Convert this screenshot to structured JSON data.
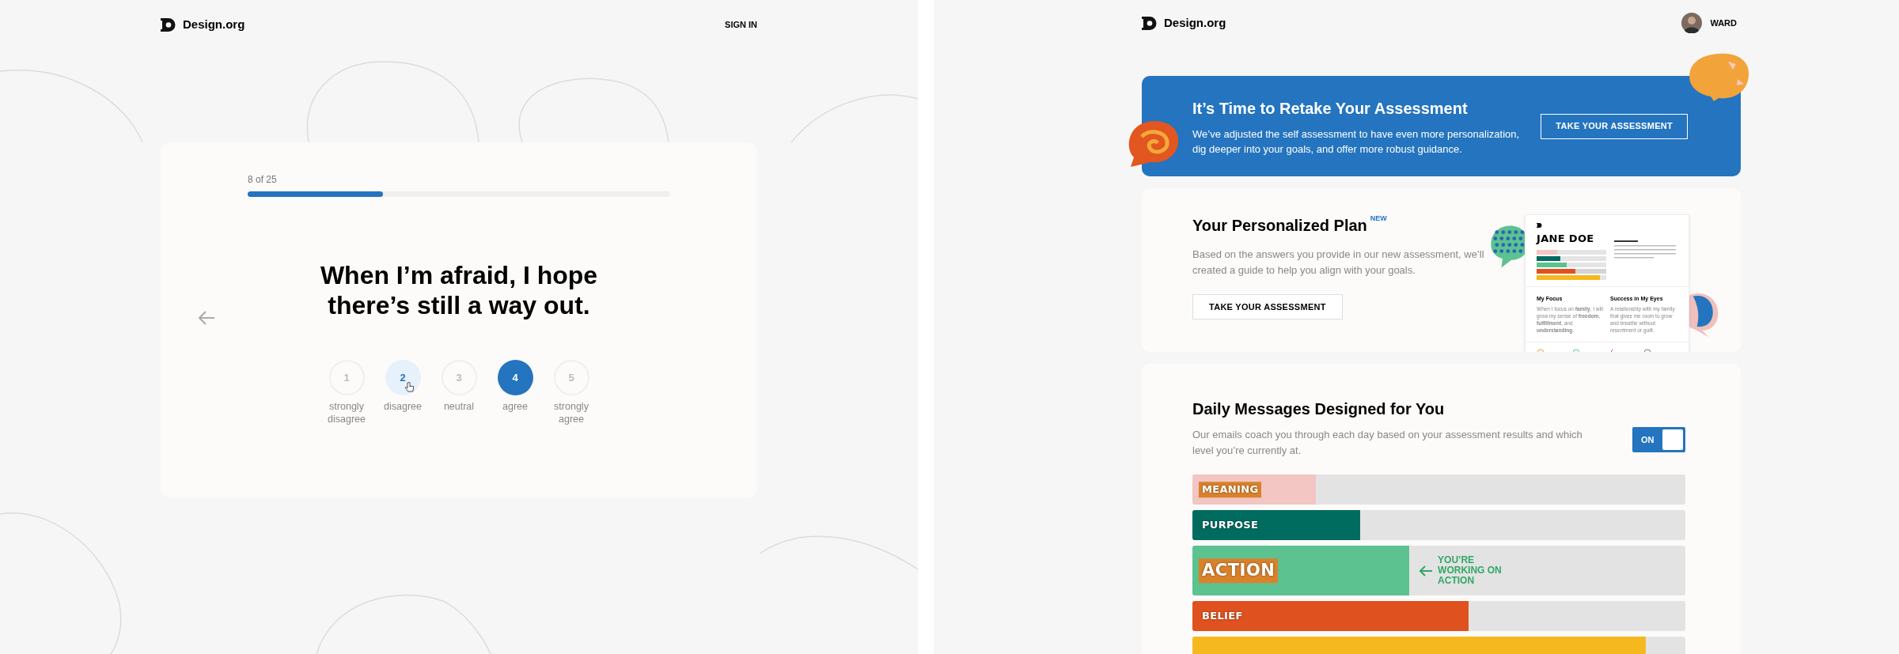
{
  "quiz_page": {
    "logo": "Design.org",
    "sign_in": "SIGN IN",
    "progress": {
      "label": "8 of 25",
      "level": 0.32
    },
    "question": "When I’m afraid, I hope there’s still a way out.",
    "options": [
      {
        "number": "1",
        "label": "strongly disagree",
        "selected": false,
        "hovered": false
      },
      {
        "number": "2",
        "label": "disagree",
        "selected": false,
        "hovered": true
      },
      {
        "number": "3",
        "label": "neutral",
        "selected": false,
        "hovered": false
      },
      {
        "number": "4",
        "label": "agree",
        "selected": true,
        "hovered": false
      },
      {
        "number": "5",
        "label": "strongly agree",
        "selected": false,
        "hovered": false
      }
    ]
  },
  "dashboard": {
    "logo": "Design.org",
    "user": {
      "name": "WARD"
    },
    "banner": {
      "title": "It’s Time to Retake Your Assessment",
      "text": "We’ve adjusted the self assessment to have even more personalization, dig deeper into your goals, and offer more robust guidance.",
      "button": "TAKE YOUR ASSESSMENT"
    },
    "plan": {
      "title": "Your Personalized Plan",
      "badge": "NEW",
      "text": "Based on the answers you provide in our new assessment, we’ll created a guide to help you align with your goals.",
      "button": "TAKE YOUR ASSESSMENT",
      "preview": {
        "name": "JANE DOE",
        "focus_heading": "My Focus",
        "focus_text": "When I focus on **family**, I will grow my sense of **freedom**, **fulfillment**, and **understanding**.",
        "success_heading": "Success in My Eyes",
        "success_text": "A relationship with my family that gives me room to grow and breathe without resentment or guilt."
      }
    },
    "daily": {
      "title": "Daily Messages Designed for You",
      "text": "Our emails coach you through each day based on your assessment results and which level you’re currently at.",
      "toggle": {
        "label": "ON",
        "on": true
      },
      "levels": [
        {
          "label": "MEANING",
          "color": "#f3c5c3",
          "level": 0.25,
          "current": false
        },
        {
          "label": "PURPOSE",
          "color": "#006b5f",
          "level": 0.34,
          "current": false
        },
        {
          "label": "ACTION",
          "color": "#5cc290",
          "level": 0.44,
          "current": true,
          "note": "YOU’RE WORKING ON ACTION"
        },
        {
          "label": "BELIEF",
          "color": "#df521f",
          "level": 0.56,
          "current": false
        },
        {
          "color": "#f5b81f",
          "level": 0.92,
          "current": false
        }
      ]
    }
  }
}
